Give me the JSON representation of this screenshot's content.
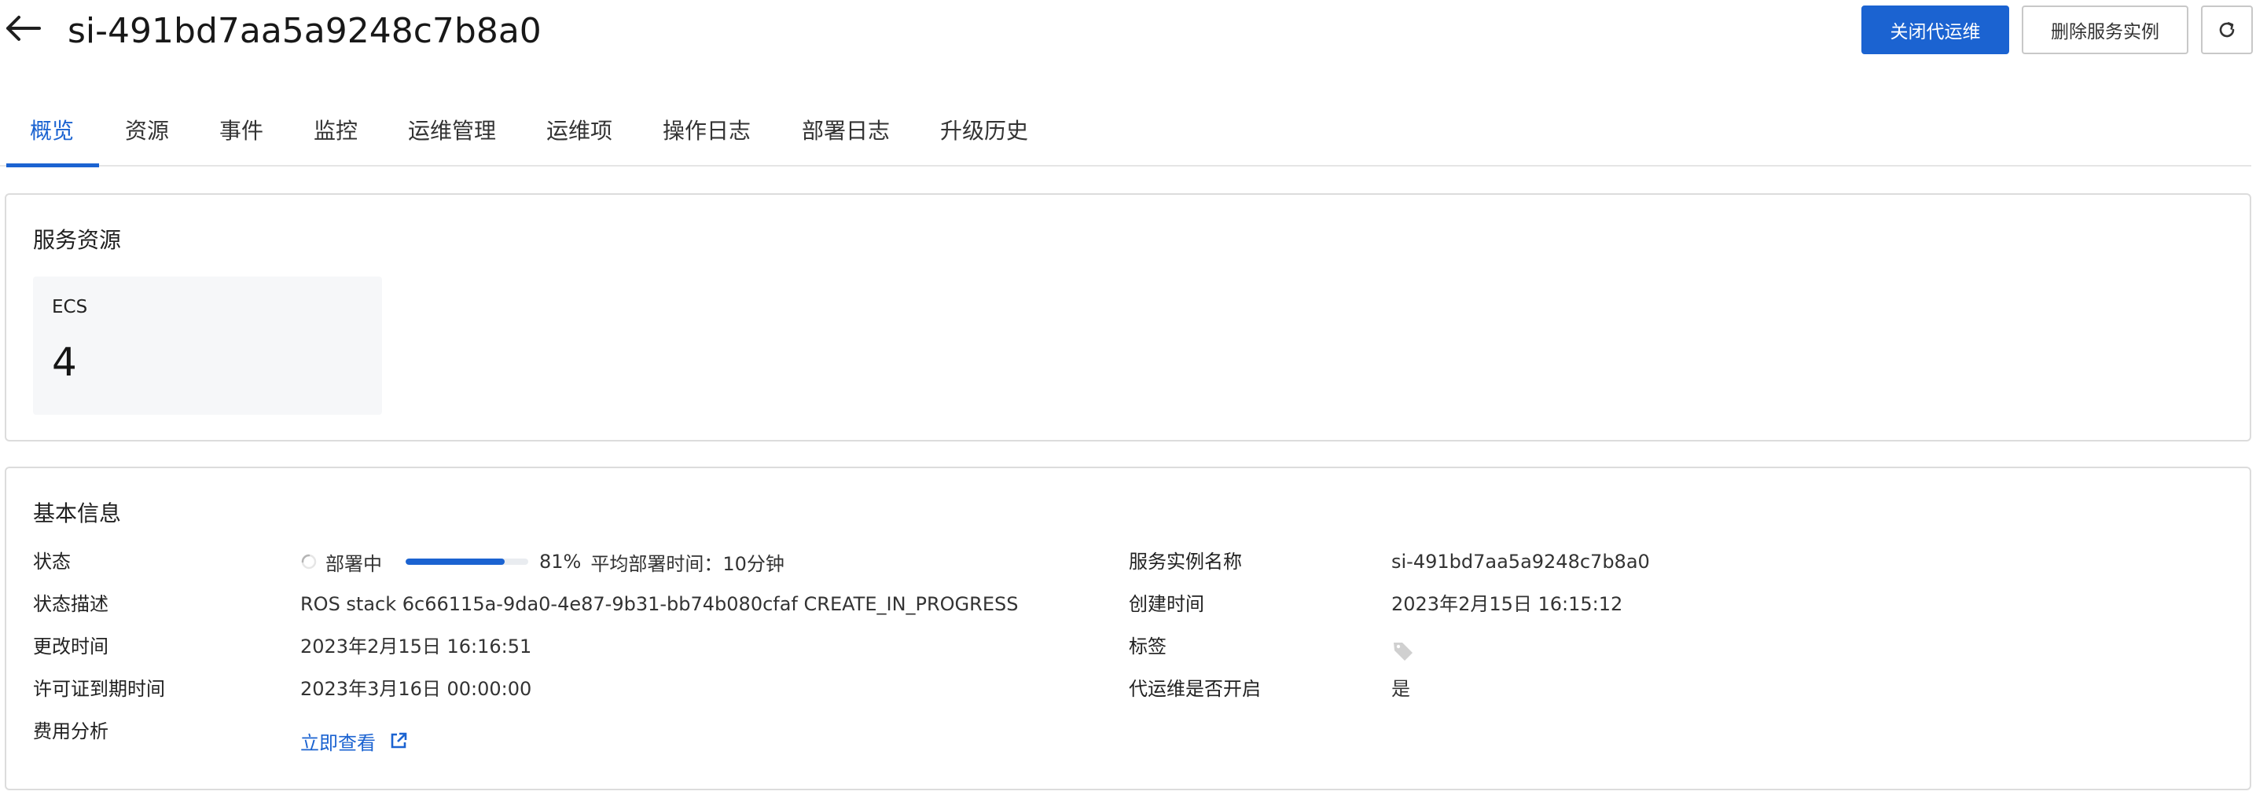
{
  "header": {
    "title": "si-491bd7aa5a9248c7b8a0",
    "primary_button": "关闭代运维",
    "delete_button": "删除服务实例"
  },
  "tabs": [
    "概览",
    "资源",
    "事件",
    "监控",
    "运维管理",
    "运维项",
    "操作日志",
    "部署日志",
    "升级历史"
  ],
  "active_tab": "概览",
  "service_resources": {
    "title": "服务资源",
    "items": [
      {
        "name": "ECS",
        "count": "4"
      }
    ]
  },
  "basic_info": {
    "title": "基本信息",
    "left": [
      {
        "label": "状态"
      },
      {
        "label": "状态描述",
        "value": "ROS stack 6c66115a-9da0-4e87-9b31-bb74b080cfaf CREATE_IN_PROGRESS"
      },
      {
        "label": "更改时间",
        "value": "2023年2月15日 16:16:51"
      },
      {
        "label": "许可证到期时间",
        "value": "2023年3月16日 00:00:00"
      },
      {
        "label": "费用分析"
      }
    ],
    "status": {
      "text": "部署中",
      "progress_percent": 81,
      "percent_label": "81%",
      "avg_time": "平均部署时间：10分钟"
    },
    "cost_link": "立即查看",
    "right": [
      {
        "label": "服务实例名称",
        "value": "si-491bd7aa5a9248c7b8a0"
      },
      {
        "label": "创建时间",
        "value": "2023年2月15日 16:15:12"
      },
      {
        "label": "标签"
      },
      {
        "label": "代运维是否开启",
        "value": "是"
      }
    ]
  },
  "colors": {
    "primary": "#1b63d1",
    "border": "#dcdcdc",
    "resource_bg": "#f6f7f9"
  }
}
